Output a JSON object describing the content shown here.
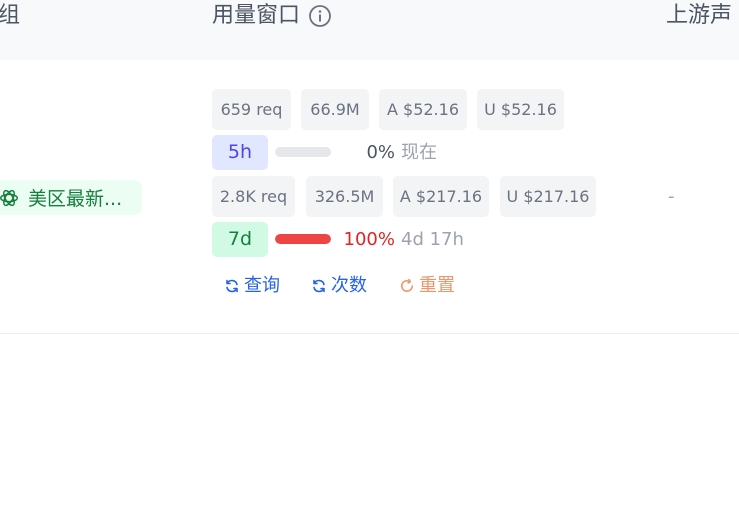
{
  "header": {
    "group": "组",
    "usage_window": "用量窗口",
    "upstream": "上游声"
  },
  "group": {
    "name": "美区最新..."
  },
  "windows": [
    {
      "badge": "5h",
      "requests": "659 req",
      "tokens": "66.9M",
      "a_cost": "A $52.16",
      "u_cost": "U $52.16",
      "percent_text": "0%",
      "percent": 0,
      "reset": "现在",
      "bar_color": "#d1d5db"
    },
    {
      "badge": "7d",
      "requests": "2.8K req",
      "tokens": "326.5M",
      "a_cost": "A $217.16",
      "u_cost": "U $217.16",
      "percent_text": "100%",
      "percent": 100,
      "reset": "4d 17h",
      "bar_color": "#ef4444"
    }
  ],
  "actions": {
    "query": "查询",
    "count": "次数",
    "reset": "重置"
  },
  "upstream_value": "-",
  "colors": {
    "link": "#2563eb",
    "reset_link": "#f0956b",
    "danger": "#dc2626"
  }
}
